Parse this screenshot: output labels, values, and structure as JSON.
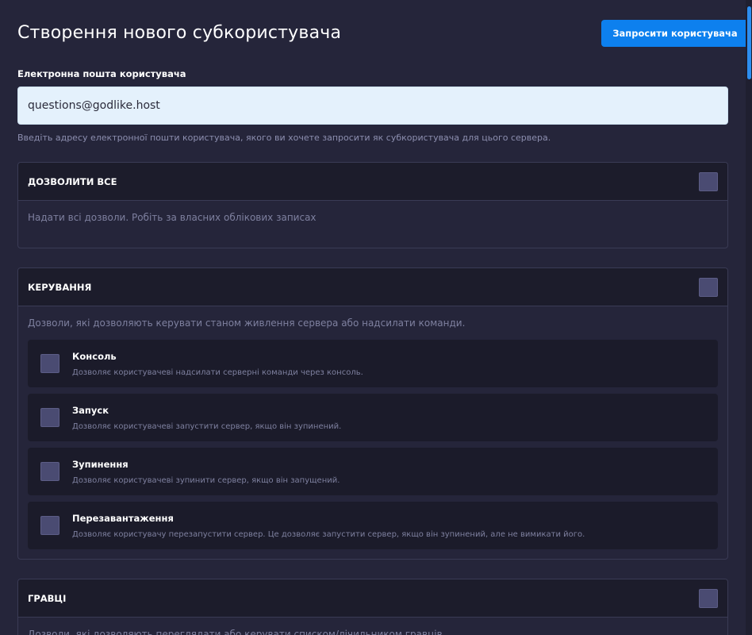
{
  "header": {
    "title": "Створення нового субкористувача",
    "invite_label": "Запросити користувача"
  },
  "email": {
    "label": "Електронна пошта користувача",
    "value": "questions@godlike.host",
    "help": "Введіть адресу електронної пошти користувача, якого ви хочете запросити як субкористувача для цього сервера."
  },
  "groups": {
    "allow_all": {
      "title": "ДОЗВОЛИТИ ВСЕ",
      "description": "Надати всі дозволи. Робіть за власних облікових записах"
    },
    "control": {
      "title": "КЕРУВАННЯ",
      "description": "Дозволи, які дозволяють керувати станом живлення сервера або надсилати команди.",
      "permissions": [
        {
          "title": "Консоль",
          "description": "Дозволяє користувачеві надсилати серверні команди через консоль."
        },
        {
          "title": "Запуск",
          "description": "Дозволяє користувачеві запустити сервер, якщо він зупинений."
        },
        {
          "title": "Зупинення",
          "description": "Дозволяє користувачеві зупинити сервер, якщо він запущений."
        },
        {
          "title": "Перезавантаження",
          "description": "Дозволяє користувачу перезапустити сервер. Це дозволяє запустити сервер, якщо він зупинений, але не вимикати його."
        }
      ]
    },
    "players": {
      "title": "ГРАВЦІ",
      "description": "Дозволи, які дозволяють переглядати або керувати списком/лічильником гравців."
    }
  },
  "colors": {
    "background": "#25253a",
    "accent": "#0d80ee",
    "checkbox": "#4a4b72"
  }
}
